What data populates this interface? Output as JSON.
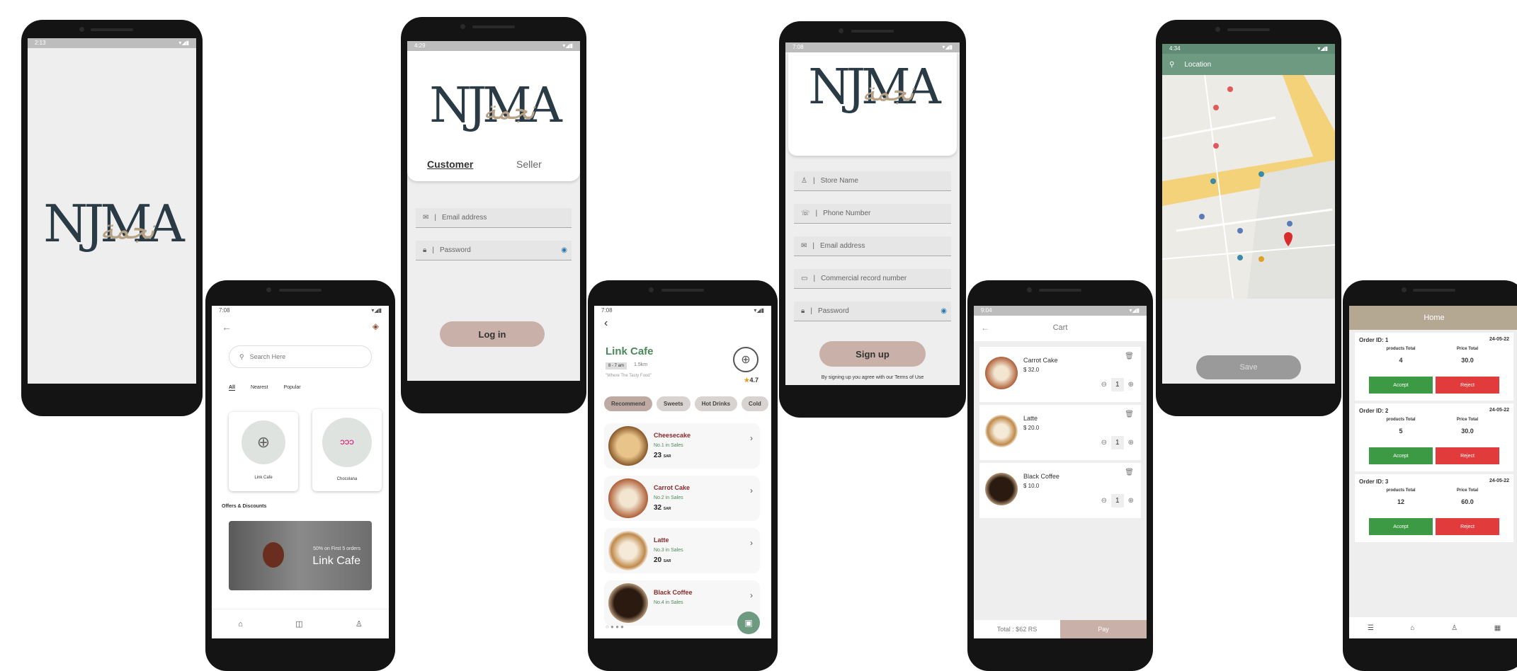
{
  "splash": {
    "time": "2:13",
    "logo": "NJMA",
    "logo_cal": "نجمة"
  },
  "login": {
    "time": "4:29",
    "logo": "NJMA",
    "logo_cal": "نجمة",
    "tab_customer": "Customer",
    "tab_seller": "Seller",
    "email_placeholder": "Email address",
    "password_placeholder": "Password",
    "login_button": "Log in"
  },
  "home": {
    "time": "7:08",
    "search_placeholder": "Search Here",
    "tabs": [
      "All",
      "Nearest",
      "Popular"
    ],
    "stores": [
      {
        "name": "Link Cafe"
      },
      {
        "name": "Chocolana"
      }
    ],
    "offers_title": "Offers & Discounts",
    "banner_sub": "50% on First 5 orders",
    "banner_title": "Link Cafe",
    "bottom_nav": [
      "home-icon",
      "bag-icon",
      "person-icon"
    ]
  },
  "menu": {
    "time": "7:08",
    "cafe_name": "Link Cafe",
    "hours": "8 - 7 am",
    "distance": "1.5km",
    "slogan": "\"Where The Tasty Food\"",
    "rating": "4.7",
    "categories": [
      "Recommend",
      "Sweets",
      "Hot Drinks",
      "Cold"
    ],
    "items": [
      {
        "name": "Cheesecake",
        "stat": "No.1 in Sales",
        "price": "23",
        "cur": "SAR"
      },
      {
        "name": "Carrot Cake",
        "stat": "No.2 in Sales",
        "price": "32",
        "cur": "SAR"
      },
      {
        "name": "Latte",
        "stat": "No.3 in Sales",
        "price": "20",
        "cur": "SAR"
      },
      {
        "name": "Black Coffee",
        "stat": "No.4 in Sales",
        "price": "",
        "cur": ""
      }
    ]
  },
  "signup": {
    "time": "7:08",
    "logo": "NJMA",
    "logo_cal": "نجمة",
    "fields": [
      "Store Name",
      "Phone Number",
      "Email address",
      "Commercial record number",
      "Password"
    ],
    "signup_button": "Sign up",
    "terms": "By signing up you agree with our Terms of Use"
  },
  "cart": {
    "time": "9:04",
    "title": "Cart",
    "items": [
      {
        "name": "Carrot Cake",
        "price": "$ 32.0",
        "qty": "1"
      },
      {
        "name": "Latte",
        "price": "$ 20.0",
        "qty": "1"
      },
      {
        "name": "Black Coffee",
        "price": "$ 10.0",
        "qty": "1"
      }
    ],
    "total": "Total : $62 RS",
    "pay": "Pay"
  },
  "location": {
    "time": "4:34",
    "title": "Location",
    "save": "Save"
  },
  "orders": {
    "title": "Home",
    "products_label": "products Total",
    "price_label": "Price Total",
    "accept": "Accept",
    "reject": "Reject",
    "list": [
      {
        "id": "Order ID: 1",
        "date": "24-05-22",
        "products": "4",
        "price": "30.0"
      },
      {
        "id": "Order ID: 2",
        "date": "24-05-22",
        "products": "5",
        "price": "30.0"
      },
      {
        "id": "Order ID: 3",
        "date": "24-05-22",
        "products": "12",
        "price": "60.0"
      }
    ]
  },
  "colors": {
    "accent_tan": "#c9b0a8",
    "green": "#3c9a45",
    "red": "#e23b3b",
    "map_header": "#6f9a82",
    "orders_header": "#b5a893"
  }
}
